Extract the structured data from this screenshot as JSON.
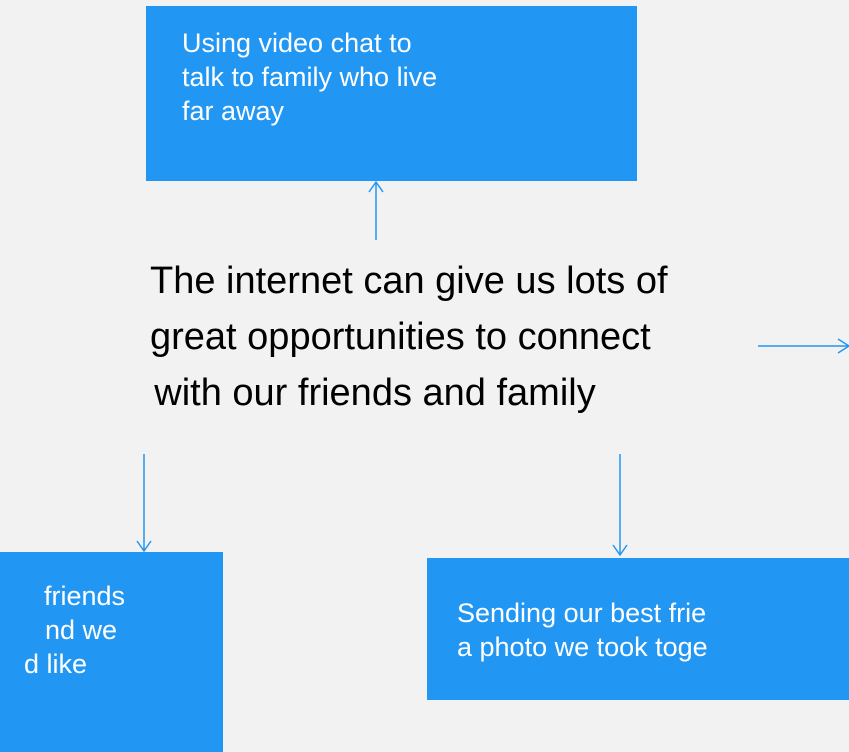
{
  "central": {
    "lines": [
      "The internet can give us lots of",
      "great opportunities to connect",
      "with our friends and family"
    ]
  },
  "boxes": {
    "top": {
      "lines": [
        "Using video chat to",
        "talk to family who live",
        "far away"
      ]
    },
    "left": {
      "lines": [
        "friends",
        "nd we",
        "d like"
      ]
    },
    "right": {
      "lines": [
        "Sending our best frie",
        "a photo we took toge"
      ]
    }
  },
  "colors": {
    "box_fill": "#2196f3",
    "box_text": "#ffffff",
    "arrow": "#2196f3",
    "background": "#f2f2f2",
    "central_text": "#000000"
  }
}
